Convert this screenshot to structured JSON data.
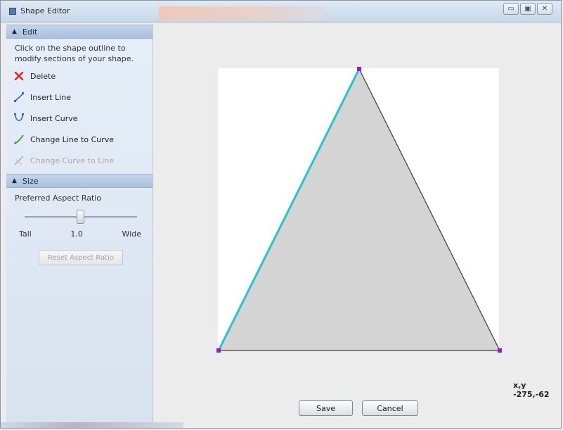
{
  "window": {
    "title": "Shape Editor",
    "blurred_tab_text": "Microsoft Visual Studio Sample Template",
    "buttons": [
      "▭",
      "▣",
      "✕"
    ]
  },
  "sidebar": {
    "edit_section": {
      "header": "Edit",
      "help_text": "Click on the shape outline to modify sections of your shape.",
      "commands": [
        {
          "label": "Delete",
          "icon": "delete-icon",
          "enabled": true
        },
        {
          "label": "Insert Line",
          "icon": "insert-line-icon",
          "enabled": true
        },
        {
          "label": "Insert Curve",
          "icon": "insert-curve-icon",
          "enabled": true
        },
        {
          "label": "Change Line to Curve",
          "icon": "line-to-curve-icon",
          "enabled": true
        },
        {
          "label": "Change Curve to Line",
          "icon": "curve-to-line-icon",
          "enabled": false
        }
      ]
    },
    "size_section": {
      "header": "Size",
      "aspect_label": "Preferred Aspect Ratio",
      "slider_value": 0.5,
      "tick_left": "Tall",
      "tick_mid": "1.0",
      "tick_right": "Wide",
      "reset_button": "Reset Aspect Ratio"
    }
  },
  "canvas": {
    "coordinates": "x,y -275,-62",
    "save_button": "Save",
    "cancel_button": "Cancel"
  },
  "colors": {
    "shape_fill": "#d4d4d4",
    "selected_edge": "#22c6d0",
    "vertex": "#a016c8",
    "delete_red": "#e02020"
  }
}
